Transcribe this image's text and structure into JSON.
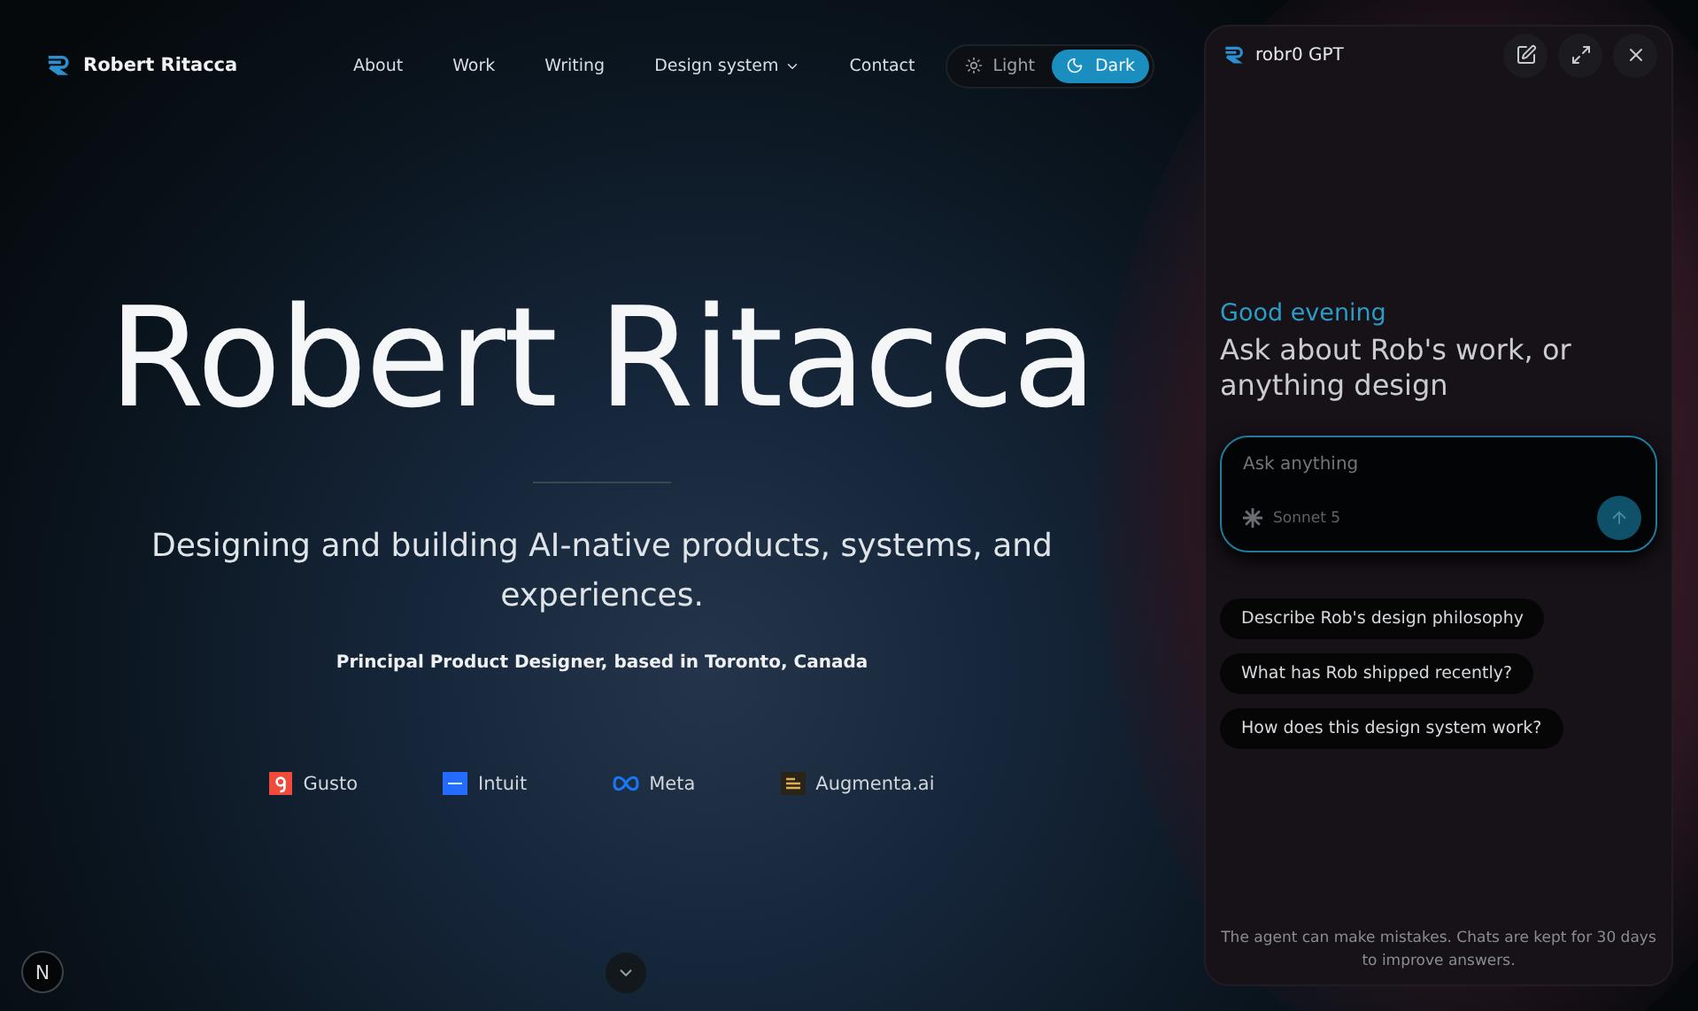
{
  "brand": {
    "name": "Robert Ritacca"
  },
  "nav": [
    {
      "label": "About",
      "dropdown": false
    },
    {
      "label": "Work",
      "dropdown": false
    },
    {
      "label": "Writing",
      "dropdown": false
    },
    {
      "label": "Design system",
      "dropdown": true
    },
    {
      "label": "Contact",
      "dropdown": false
    }
  ],
  "theme_toggle": [
    {
      "label": "Light",
      "kind": "sun",
      "selected": false
    },
    {
      "label": "Dark",
      "kind": "moon",
      "selected": true
    }
  ],
  "hero": {
    "title": "Robert Ritacca",
    "subtitle": "Designing and building AI-native products, systems, and experiences.",
    "role": "Principal Product Designer, based in Toronto, Canada"
  },
  "companies": [
    {
      "name": "Gusto",
      "kind": "gusto"
    },
    {
      "name": "Intuit",
      "kind": "intuit"
    },
    {
      "name": "Meta",
      "kind": "meta"
    },
    {
      "name": "Augmenta.ai",
      "kind": "augmenta"
    }
  ],
  "dev_badge": "N",
  "chat": {
    "title": "robr0 GPT",
    "greeting": "Good evening",
    "prompt": "Ask about Rob's work, or anything design",
    "input": {
      "placeholder": "Ask anything"
    },
    "model": "Sonnet 5",
    "suggestions": [
      "Describe Rob's design philosophy",
      "What has Rob shipped recently?",
      "How does this design system work?"
    ],
    "disclaimer": "The agent can make mistakes. Chats are kept for 30 days to improve answers."
  }
}
